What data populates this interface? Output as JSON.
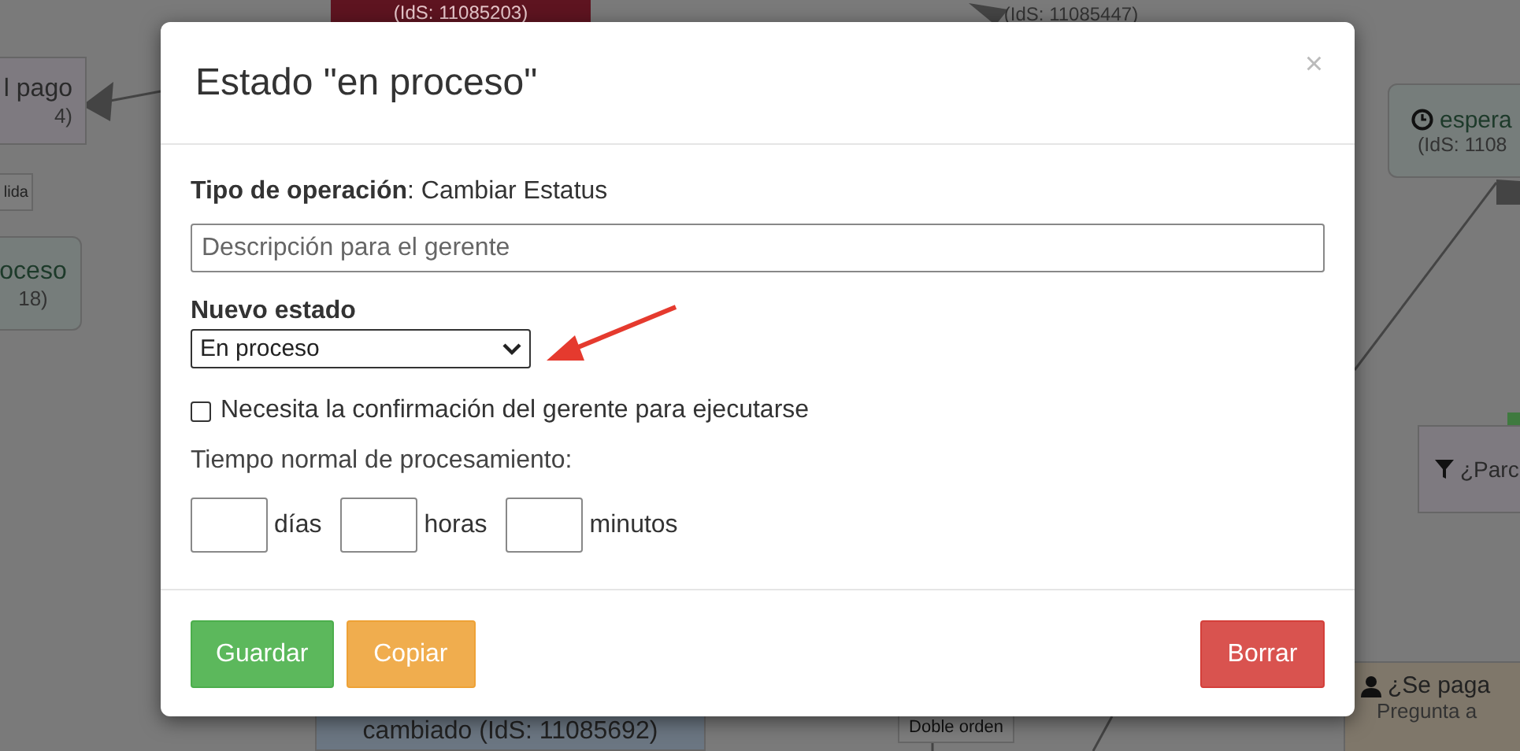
{
  "canvas": {
    "nodes": [
      {
        "kind": "status",
        "lines": [
          "l pago",
          "4)"
        ]
      },
      {
        "kind": "tagedge",
        "lines": [
          "lida"
        ]
      },
      {
        "kind": "rounded",
        "lines": [
          "oceso",
          "18)"
        ]
      },
      {
        "kind": "red",
        "lines": [
          "(IdS: 11085203)"
        ]
      },
      {
        "kind": "plain",
        "lines": [
          "(IdS: 11085447)"
        ]
      },
      {
        "kind": "timer",
        "lines": [
          "espera",
          "(IdS: 1108"
        ]
      },
      {
        "kind": "filter",
        "lines": [
          "¿Parc"
        ]
      },
      {
        "kind": "blue",
        "lines": [
          "cambiado (IdS: 11085692)"
        ]
      },
      {
        "kind": "tag",
        "lines": [
          "Doble orden"
        ]
      },
      {
        "kind": "question",
        "lines": [
          "¿Se paga",
          "Pregunta a"
        ]
      }
    ]
  },
  "dialog": {
    "title": "Estado \"en proceso\"",
    "close": "×",
    "operation_label": "Tipo de operación",
    "operation_value": ": Cambiar Estatus",
    "description": {
      "placeholder": "Descripción para el gerente"
    },
    "state_label": "Nuevo estado",
    "state_value": "En proceso",
    "confirm": {
      "label": "Necesita la confirmación del gerente para ejecutarse",
      "checked": false
    },
    "time_label": "Tiempo normal de procesamiento:",
    "time_fields": [
      {
        "unit": "días"
      },
      {
        "unit": "horas"
      },
      {
        "unit": "minutos"
      }
    ],
    "buttons": [
      {
        "label": "Guardar",
        "kind": "success"
      },
      {
        "label": "Copiar",
        "kind": "warning"
      },
      {
        "label": "Borrar",
        "kind": "danger"
      }
    ]
  }
}
